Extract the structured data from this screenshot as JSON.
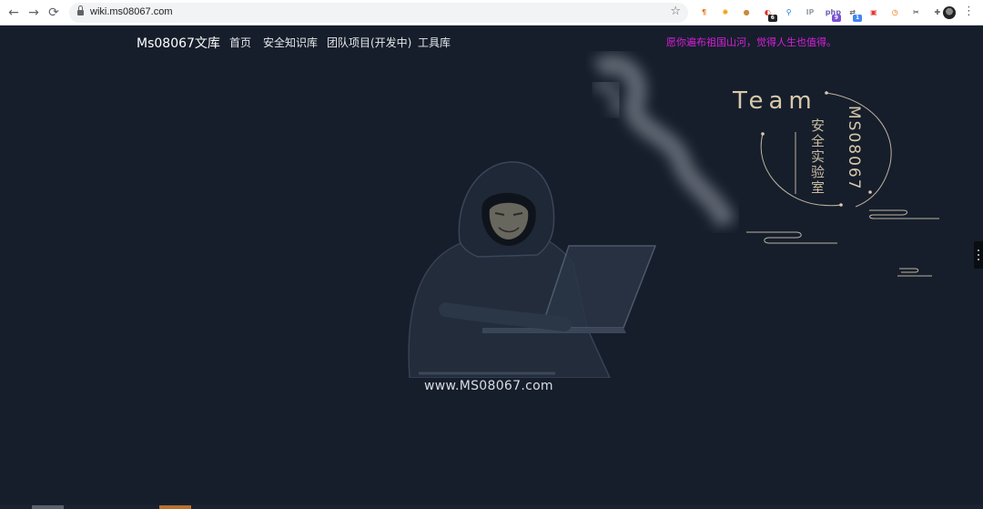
{
  "browser": {
    "url": "wiki.ms08067.com",
    "back_icon": "←",
    "forward_icon": "→",
    "reload_icon": "⟳",
    "star_icon": "☆",
    "menu_icon": "⋮",
    "extensions": [
      {
        "name": "pilcrow-extension-icon",
        "glyph": "¶",
        "color": "#e8710a"
      },
      {
        "name": "orange-extension-icon",
        "glyph": "✺",
        "color": "#f29900"
      },
      {
        "name": "cookie-extension-icon",
        "glyph": "●",
        "color": "#c98a3a"
      },
      {
        "name": "badge-extension-icon",
        "glyph": "◐",
        "color": "#d93025",
        "badge": "6",
        "badge_color": "#202124"
      },
      {
        "name": "location-pin-extension-icon",
        "glyph": "⚲",
        "color": "#1a73e8"
      },
      {
        "name": "ip-extension-icon",
        "glyph": "IP",
        "color": "#9aa0a6"
      },
      {
        "name": "php-extension-icon",
        "glyph": "php",
        "color": "#6b5fb5",
        "badge": "9",
        "badge_color": "#7b4fd6"
      },
      {
        "name": "proxy-extension-icon",
        "glyph": "⇄",
        "color": "#5f6368",
        "badge": "1",
        "badge_color": "#4285f4"
      },
      {
        "name": "image-extension-icon",
        "glyph": "▣",
        "color": "#e53935"
      },
      {
        "name": "clock-extension-icon",
        "glyph": "◷",
        "color": "#ef6c00"
      },
      {
        "name": "scissors-extension-icon",
        "glyph": "✂",
        "color": "#202124"
      },
      {
        "name": "puzzle-extension-icon",
        "glyph": "✚",
        "color": "#5f6368"
      }
    ]
  },
  "site": {
    "brand": "Ms08067文库",
    "nav": [
      "首页",
      "安全知识库",
      "团队项目(开发中)",
      "工具库"
    ],
    "motto": "愿你遍布祖国山河，觉得人生也值得。",
    "accent": "#d81fd9",
    "background": "#161e2c"
  },
  "hero": {
    "team_word": "Team",
    "team_chinese": "安全实验室",
    "team_id": "MS08067",
    "website": "www.MS08067.com"
  }
}
